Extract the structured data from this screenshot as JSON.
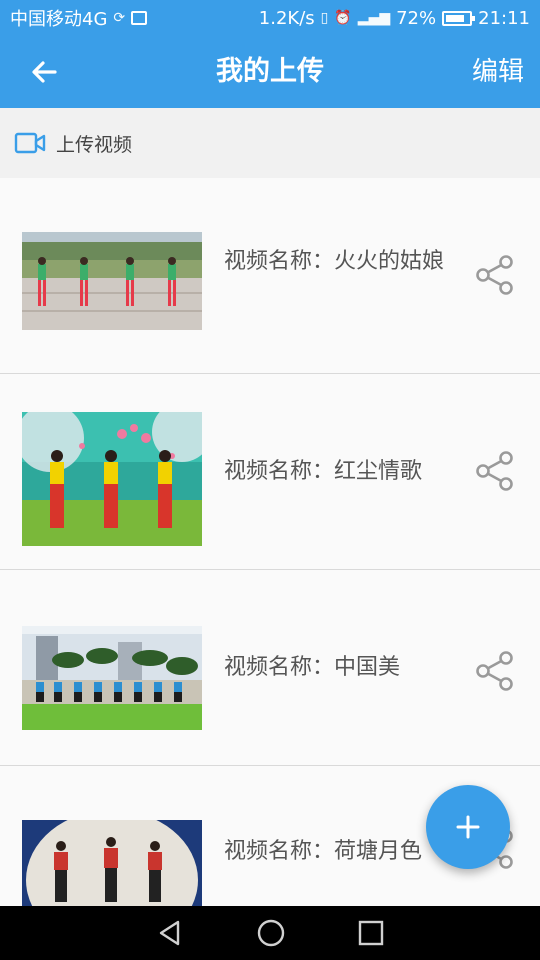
{
  "status_bar": {
    "carrier": "中国移动4G",
    "speed": "1.2K/s",
    "battery": "72%",
    "time": "21:11"
  },
  "app_bar": {
    "title": "我的上传",
    "edit_label": "编辑",
    "back_icon": "arrow-left-icon"
  },
  "upload": {
    "label": "上传视频",
    "icon": "video-camera-icon"
  },
  "videos": [
    {
      "name": "视频名称：火火的姑娘"
    },
    {
      "name": "视频名称：红尘情歌"
    },
    {
      "name": "视频名称：中国美"
    },
    {
      "name": "视频名称：荷塘月色"
    }
  ],
  "fab": {
    "icon": "plus-icon"
  },
  "colors": {
    "primary": "#3a9ee8",
    "text": "#555555",
    "divider": "#d9d9d9"
  }
}
